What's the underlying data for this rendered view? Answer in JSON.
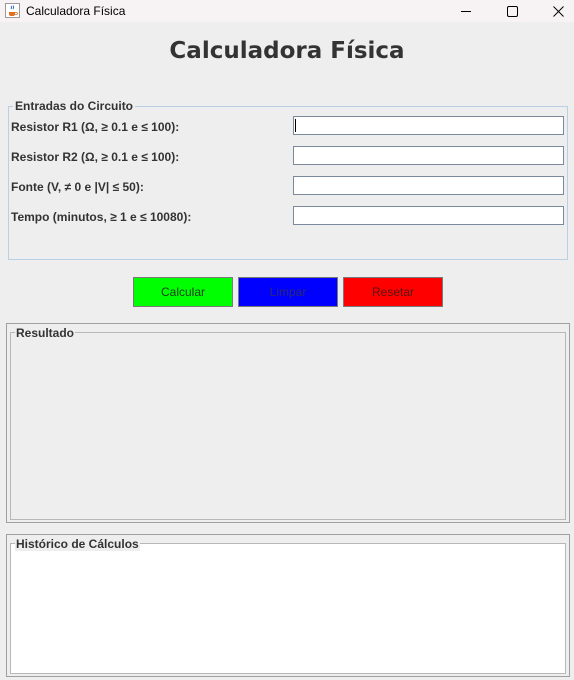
{
  "window": {
    "title": "Calculadora Física",
    "icons": {
      "app": "java-cup-icon",
      "minimize": "minimize-icon",
      "maximize": "maximize-icon",
      "close": "close-icon"
    }
  },
  "header": {
    "title": "Calculadora Física"
  },
  "inputs_group": {
    "legend": "Entradas do Circuito",
    "fields": [
      {
        "label": "Resistor R1 (Ω, ≥ 0.1 e ≤ 100):",
        "value": "",
        "focused": true
      },
      {
        "label": "Resistor R2 (Ω, ≥ 0.1 e ≤ 100):",
        "value": ""
      },
      {
        "label": "Fonte (V, ≠ 0 e |V| ≤ 50):",
        "value": ""
      },
      {
        "label": "Tempo (minutos, ≥ 1 e ≤ 10080):",
        "value": ""
      }
    ]
  },
  "buttons": {
    "calculate": {
      "label": "Calcular",
      "color": "#00ff00"
    },
    "clear": {
      "label": "Limpar",
      "color": "#0000ff"
    },
    "reset": {
      "label": "Resetar",
      "color": "#ff0000"
    }
  },
  "result": {
    "legend": "Resultado",
    "text": ""
  },
  "history": {
    "legend": "Histórico de Cálculos",
    "text": ""
  }
}
